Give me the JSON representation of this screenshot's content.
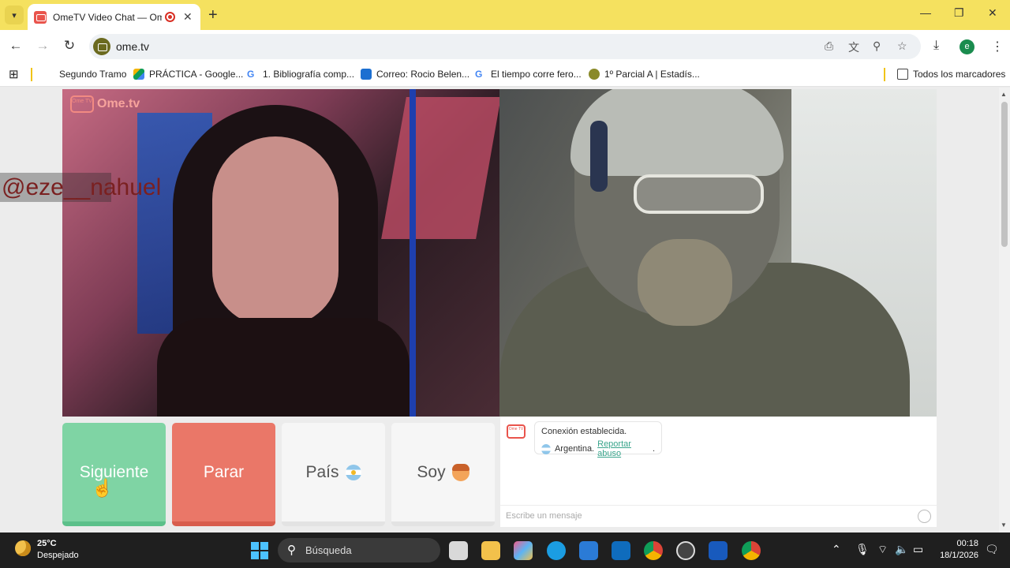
{
  "browser": {
    "tab_title": "OmeTV Video Chat — OmeTV",
    "url": "ome.tv",
    "profile_initial": "e",
    "bookmarks": [
      "Segundo Tramo",
      "PRÁCTICA - Google...",
      "1. Bibliografía comp...",
      "Correo: Rocio Belen...",
      "El tiempo corre fero...",
      "1º Parcial A | Estadís..."
    ],
    "all_bookmarks": "Todos los marcadores"
  },
  "page": {
    "logo_icon_text": "Ome TV",
    "logo_text": "Ome.tv",
    "overlay_handle": "@eze__nahuel",
    "buttons": {
      "next": "Siguiente",
      "stop": "Parar",
      "country": "País",
      "gender": "Soy"
    },
    "chat": {
      "logo_text": "Ome TV",
      "status": "Conexión establecida.",
      "country": "Argentina.",
      "report_link": "Reportar abuso",
      "report_suffix": ".",
      "input_placeholder": "Escribe un mensaje"
    }
  },
  "taskbar": {
    "temperature": "25°C",
    "weather": "Despejado",
    "search_placeholder": "Búsqueda",
    "time": "00:18",
    "date": "18/1/2026"
  },
  "colors": {
    "tab_strip": "#f5e15f",
    "next_button": "#7fd4a4",
    "stop_button": "#ea7768",
    "link": "#3aa58c"
  }
}
